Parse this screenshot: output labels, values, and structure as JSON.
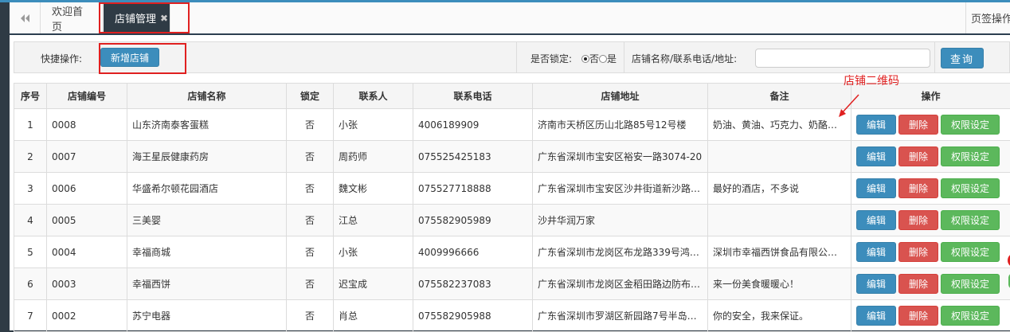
{
  "tabs": {
    "back_icon": "back-double-arrow",
    "home": "欢迎首页",
    "active": "店铺管理",
    "right": "页签操作"
  },
  "toolbar": {
    "quick_label": "快捷操作:",
    "add_button": "新增店铺",
    "lock_label": "是否锁定:",
    "lock_no": "否",
    "lock_yes": "是",
    "lock_selected": "否",
    "search_label": "店铺名称/联系电话/地址:",
    "search_value": "",
    "search_button": "查询"
  },
  "annotation": "店铺二维码",
  "table": {
    "headers": [
      "序号",
      "店铺编号",
      "店铺名称",
      "锁定",
      "联系人",
      "联系电话",
      "店铺地址",
      "备注",
      "操作"
    ],
    "actions": {
      "edit": "编辑",
      "delete": "删除",
      "perm": "权限设定"
    },
    "rows": [
      {
        "idx": "1",
        "code": "0008",
        "name": "山东济南泰客蛋糕",
        "locked": "否",
        "contact": "小张",
        "phone": "4006189909",
        "address": "济南市天桥区历山北路85号12号楼",
        "note": "奶油、黄油、巧克力、奶酪…"
      },
      {
        "idx": "2",
        "code": "0007",
        "name": "海王星辰健康药房",
        "locked": "否",
        "contact": "周药师",
        "phone": "075525425183",
        "address": "广东省深圳市宝安区裕安一路3074-20",
        "note": ""
      },
      {
        "idx": "3",
        "code": "0006",
        "name": "华盛希尔顿花园酒店",
        "locked": "否",
        "contact": "魏文彬",
        "phone": "075527718888",
        "address": "广东省深圳市宝安区沙井街道新沙路…",
        "note": "最好的酒店，不多说"
      },
      {
        "idx": "4",
        "code": "0005",
        "name": "三美婴",
        "locked": "否",
        "contact": "江总",
        "phone": "075582905989",
        "address": "沙井华润万家",
        "note": ""
      },
      {
        "idx": "5",
        "code": "0004",
        "name": "幸福商城",
        "locked": "否",
        "contact": "小张",
        "phone": "4009996666",
        "address": "广东省深圳市龙岗区布龙路339号鸿…",
        "note": "深圳市幸福西饼食品有限公司…"
      },
      {
        "idx": "6",
        "code": "0003",
        "name": "幸福西饼",
        "locked": "否",
        "contact": "迟宝成",
        "phone": "075582237083",
        "address": "广东省深圳市龙岗区金稻田路边防布…",
        "note": "来一份美食暖暖心！"
      },
      {
        "idx": "7",
        "code": "0002",
        "name": "苏宁电器",
        "locked": "否",
        "contact": "肖总",
        "phone": "075582905988",
        "address": "广东省深圳市罗湖区新园路7号半岛…",
        "note": "你的安全，我来保证。"
      }
    ]
  },
  "colors": {
    "primary": "#3c8dbc",
    "danger": "#d9534f",
    "success": "#5cb85c",
    "annotation": "#e02020"
  }
}
